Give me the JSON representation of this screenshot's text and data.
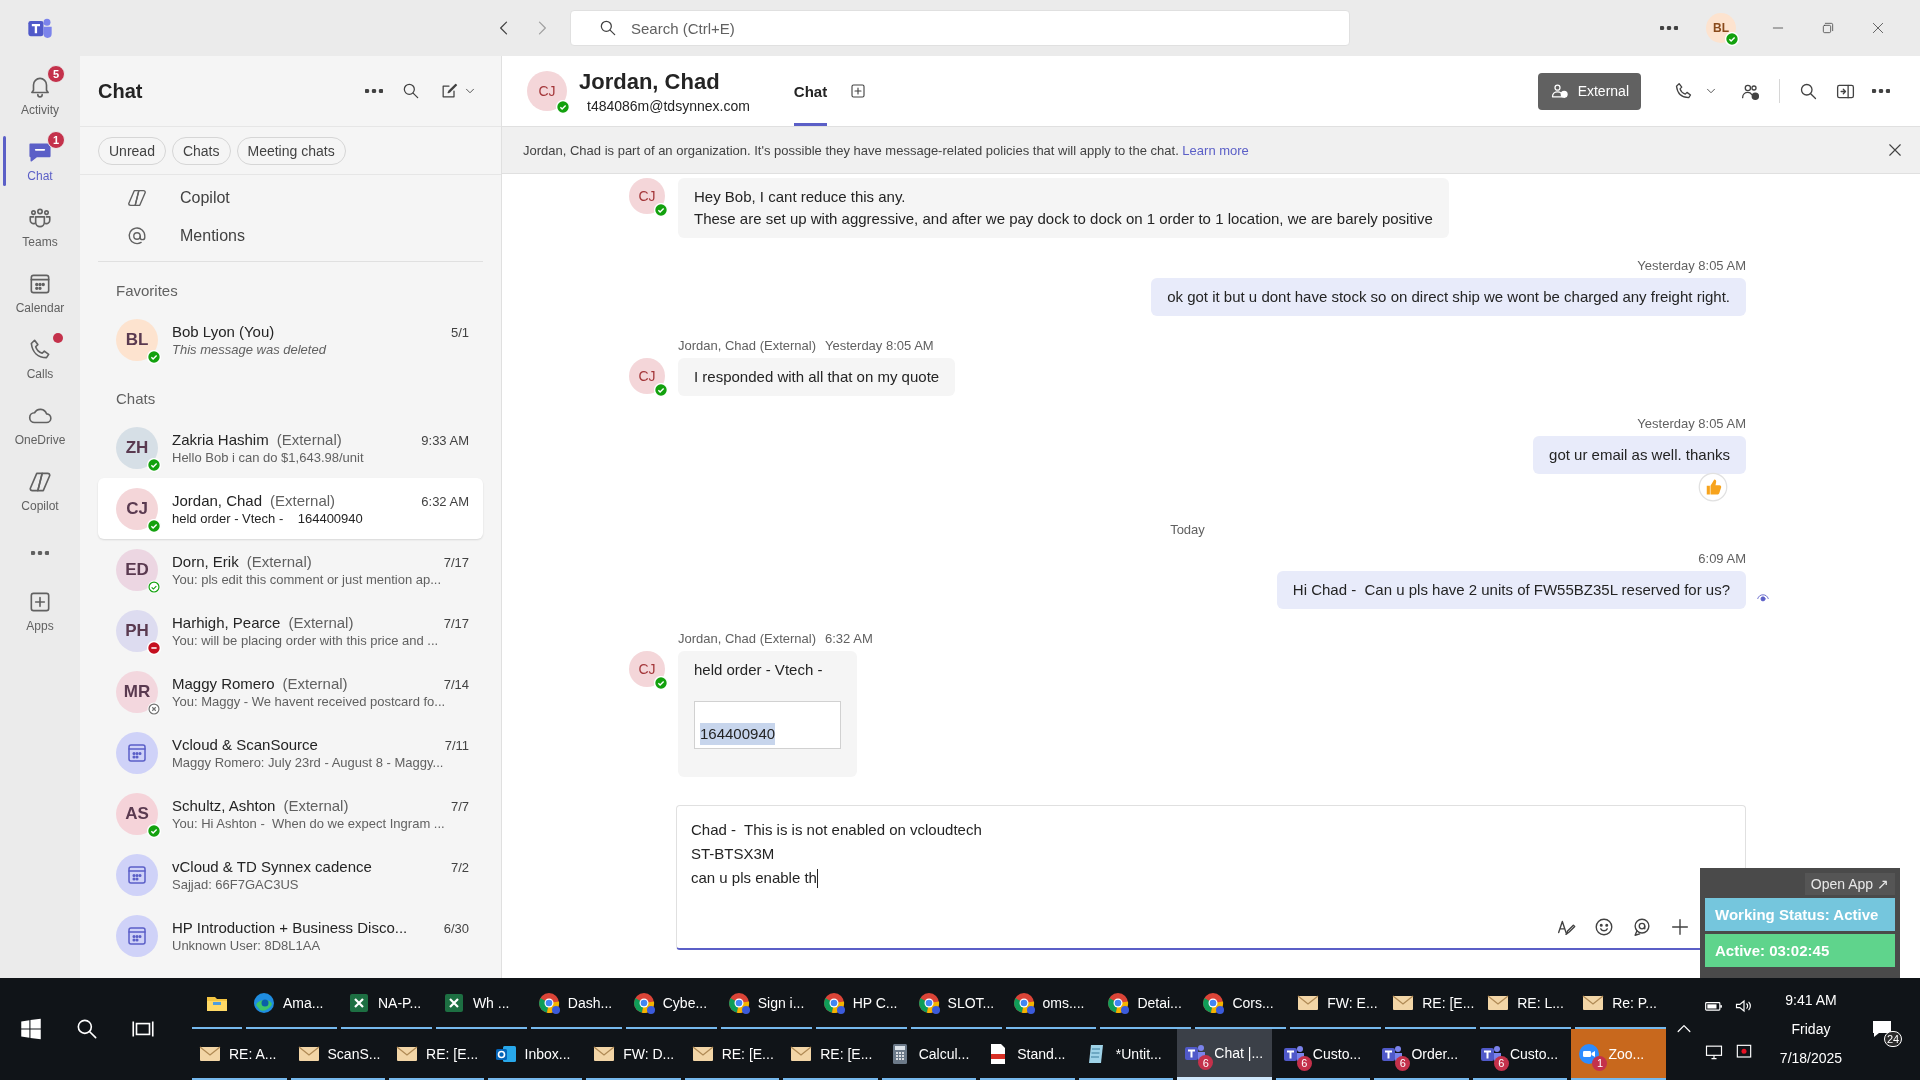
{
  "title_bar": {
    "search": {
      "placeholder": "Search (Ctrl+E)"
    },
    "account": {
      "initials": "BL",
      "color": "#fde3cf",
      "presence": {
        "kind": "available"
      }
    }
  },
  "rail": {
    "items": [
      {
        "label": "Activity",
        "selected": false,
        "badge": "5",
        "dot": false
      },
      {
        "label": "Chat",
        "selected": true,
        "badge": "1",
        "dot": false
      },
      {
        "label": "Teams",
        "selected": false,
        "dot": false
      },
      {
        "label": "Calendar",
        "selected": false,
        "dot": false
      },
      {
        "label": "Calls",
        "selected": false,
        "dot": true
      },
      {
        "label": "OneDrive",
        "selected": false,
        "dot": false
      },
      {
        "label": "Copilot",
        "selected": false,
        "dot": false
      },
      {
        "selected": false,
        "dot": false
      },
      {
        "label": "Apps",
        "selected": false,
        "dot": false
      }
    ]
  },
  "chat_list": {
    "title": "Chat",
    "filters": [
      {
        "label": "Unread",
        "selected": false
      },
      {
        "label": "Chats",
        "selected": false
      },
      {
        "label": "Meeting chats",
        "selected": false
      }
    ],
    "pinned": [
      {
        "label": "Copilot"
      },
      {
        "label": "Mentions"
      }
    ],
    "sections": [
      {
        "heading": "Favorites",
        "items": [
          {
            "kind": "person",
            "initials": "BL",
            "color": "#fde3cf",
            "presence": {
              "kind": "available"
            },
            "name": "Bob Lyon (You)",
            "preview": "This message was deleted",
            "deleted": true,
            "time": "5/1",
            "selected": false
          }
        ]
      },
      {
        "heading": "Chats",
        "items": [
          {
            "kind": "person",
            "initials": "ZH",
            "color": "#d6dfe6",
            "presence": {
              "kind": "available"
            },
            "name": "Zakria Hashim",
            "tag": "(External)",
            "preview": "Hello Bob i can do $1,643.98/unit",
            "deleted": false,
            "time": "9:33 AM",
            "selected": false
          },
          {
            "kind": "person",
            "initials": "CJ",
            "color": "#f4d6d9",
            "presence": {
              "kind": "available"
            },
            "name": "Jordan, Chad",
            "tag": "(External)",
            "preview": "held order - Vtech -    164400940",
            "deleted": false,
            "time": "6:32 AM",
            "selected": true
          },
          {
            "kind": "person",
            "initials": "ED",
            "color": "#ecd6e2",
            "presence": {
              "kind": "available-out"
            },
            "name": "Dorn, Erik",
            "tag": "(External)",
            "preview": "You: pls edit this comment or just mention ap...",
            "deleted": false,
            "time": "7/17",
            "selected": false
          },
          {
            "kind": "person",
            "initials": "PH",
            "color": "#dddcf0",
            "presence": {
              "kind": "busy"
            },
            "name": "Harhigh, Pearce",
            "tag": "(External)",
            "preview": "You: will be placing order with this price and ...",
            "deleted": false,
            "time": "7/17",
            "selected": false
          },
          {
            "kind": "person",
            "initials": "MR",
            "color": "#f3d7de",
            "presence": {
              "kind": "offline"
            },
            "name": "Maggy Romero",
            "tag": "(External)",
            "preview": "You: Maggy - We havent received postcard fo...",
            "deleted": false,
            "time": "7/14",
            "selected": false
          },
          {
            "kind": "meeting",
            "color": "#cfd2f8",
            "name": "Vcloud & ScanSource",
            "preview": "Maggy Romero: July 23rd - August 8 - Maggy...",
            "deleted": false,
            "time": "7/11",
            "selected": false
          },
          {
            "kind": "person",
            "initials": "AS",
            "color": "#f5d3d9",
            "presence": {
              "kind": "available"
            },
            "name": "Schultz, Ashton",
            "tag": "(External)",
            "preview": "You: Hi Ashton -  When do we expect Ingram ...",
            "deleted": false,
            "time": "7/7",
            "selected": false
          },
          {
            "kind": "meeting",
            "color": "#cfd2f8",
            "name": "vCloud & TD Synnex cadence",
            "preview": "Sajjad: 66F7GAC3US",
            "deleted": false,
            "time": "7/2",
            "selected": false
          },
          {
            "kind": "meeting",
            "color": "#cfd2f8",
            "name": "HP Introduction + Business Disco...",
            "preview": "Unknown User: 8D8L1AA",
            "deleted": false,
            "time": "6/30",
            "selected": false
          }
        ]
      }
    ]
  },
  "conversation": {
    "initials": "CJ",
    "color": "#f4d6d9",
    "presence": {
      "kind": "available"
    },
    "name": "Jordan, Chad",
    "email": "t484086m@tdsynnex.com",
    "tabs": [
      {
        "label": "Chat",
        "selected": true
      }
    ],
    "external_label": "External"
  },
  "banner": {
    "text": "Jordan, Chad is part of an organization. It's possible they have message-related policies that will apply to the chat.",
    "link": "Learn more"
  },
  "messages": [
    {
      "kind": "incoming",
      "initials": "CJ",
      "color": "#f4d6d9",
      "presence": {
        "kind": "available"
      },
      "lines": [
        "Hey Bob, I cant reduce this any.",
        "These are set up with aggressive, and after we pay dock to dock on 1 order to 1 location, we are barely positive"
      ]
    },
    {
      "kind": "outgoing",
      "time": "Yesterday 8:05 AM",
      "lines": [
        "ok got it but u dont have stock so on direct ship we wont be charged any freight right."
      ],
      "liked": false,
      "seen": false
    },
    {
      "kind": "incoming",
      "sender": "Jordan, Chad (External)",
      "time": "Yesterday 8:05 AM",
      "initials": "CJ",
      "color": "#f4d6d9",
      "presence": {
        "kind": "available"
      },
      "lines": [
        "I responded with all that on my quote"
      ]
    },
    {
      "kind": "outgoing",
      "time": "Yesterday 8:05 AM",
      "lines": [
        "got ur email as well. thanks"
      ],
      "liked": true,
      "seen": false
    },
    {
      "kind": "divider",
      "text": "Today"
    },
    {
      "kind": "outgoing",
      "time": "6:09 AM",
      "lines": [
        "Hi Chad -  Can u pls have 2 units of FW55BZ35L reserved for us?"
      ],
      "liked": false,
      "seen": true
    },
    {
      "kind": "incoming",
      "sender": "Jordan, Chad (External)",
      "time": "6:32 AM",
      "initials": "CJ",
      "color": "#f4d6d9",
      "presence": {
        "kind": "available"
      },
      "lines": [
        "held order - Vtech -"
      ],
      "quote": "164400940",
      "quote_selected": true
    }
  ],
  "compose": {
    "lines": [
      "Chad -  This is is not enabled on vcloudtech",
      "ST-BTSX3M",
      "can u pls enable th"
    ]
  },
  "status_widget": {
    "button": "Open App ↗",
    "status": "Working Status: Active",
    "timer": "Active: 03:02:45"
  },
  "taskbar": {
    "rows": [
      {
        "items": [
          {
            "kind": "explorer",
            "selected": false,
            "attention": false
          },
          {
            "kind": "edge",
            "label": "Ama...",
            "selected": false,
            "attention": false
          },
          {
            "kind": "excel",
            "label": "NA-P...",
            "selected": false,
            "attention": false
          },
          {
            "kind": "excel",
            "label": "Wh ...",
            "selected": false,
            "attention": false
          },
          {
            "kind": "chrome",
            "label": "Dash...",
            "selected": false,
            "attention": false
          },
          {
            "kind": "chrome",
            "label": "Cybe...",
            "selected": false,
            "attention": false
          },
          {
            "kind": "chrome",
            "label": "Sign i...",
            "selected": false,
            "attention": false
          },
          {
            "kind": "chrome",
            "label": "HP C...",
            "selected": false,
            "attention": false
          },
          {
            "kind": "chrome",
            "label": "SLOT...",
            "selected": false,
            "attention": false
          },
          {
            "kind": "chrome",
            "label": "oms....",
            "selected": false,
            "attention": false
          },
          {
            "kind": "chrome",
            "label": "Detai...",
            "selected": false,
            "attention": false
          },
          {
            "kind": "chrome",
            "label": "Cors...",
            "selected": false,
            "attention": false
          },
          {
            "kind": "mail",
            "label": "FW: E...",
            "selected": false,
            "attention": false
          },
          {
            "kind": "mail",
            "label": "RE: [E...",
            "selected": false,
            "attention": false
          },
          {
            "kind": "mail",
            "label": "RE: L...",
            "selected": false,
            "attention": false
          },
          {
            "kind": "mail",
            "label": "Re: P...",
            "selected": false,
            "attention": false
          }
        ]
      },
      {
        "items": [
          {
            "kind": "mail",
            "label": "RE: A...",
            "selected": false,
            "attention": false
          },
          {
            "kind": "mail",
            "label": "ScanS...",
            "selected": false,
            "attention": false
          },
          {
            "kind": "mail",
            "label": "RE: [E...",
            "selected": false,
            "attention": false
          },
          {
            "kind": "outlook",
            "label": "Inbox...",
            "selected": false,
            "attention": false
          },
          {
            "kind": "mail",
            "label": "FW: D...",
            "selected": false,
            "attention": false
          },
          {
            "kind": "mail",
            "label": "RE: [E...",
            "selected": false,
            "attention": false
          },
          {
            "kind": "mail",
            "label": "RE: [E...",
            "selected": false,
            "attention": false
          },
          {
            "kind": "calculator",
            "label": "Calcul...",
            "selected": false,
            "attention": false
          },
          {
            "kind": "pdf",
            "label": "Stand...",
            "selected": false,
            "attention": false
          },
          {
            "kind": "paint",
            "label": "*Untit...",
            "selected": false,
            "attention": false
          },
          {
            "kind": "teams",
            "label": "Chat |...",
            "badge": "6",
            "selected": true,
            "attention": false
          },
          {
            "kind": "teams",
            "label": "Custo...",
            "badge": "6",
            "selected": false,
            "attention": false
          },
          {
            "kind": "teams",
            "label": "Order...",
            "badge": "6",
            "selected": false,
            "attention": false
          },
          {
            "kind": "teams",
            "label": "Custo...",
            "badge": "6",
            "selected": false,
            "attention": false
          },
          {
            "kind": "zoom",
            "label": "Zoo...",
            "badge": "1",
            "selected": false,
            "attention": true
          }
        ]
      }
    ],
    "tray": {
      "time": "9:41 AM",
      "day": "Friday",
      "date": "7/18/2025",
      "notifications": "24"
    }
  }
}
